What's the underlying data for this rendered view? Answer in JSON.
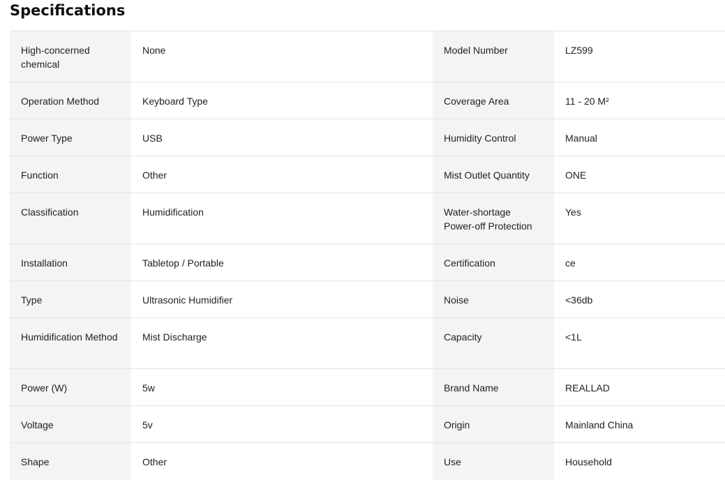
{
  "title": "Specifications",
  "rows": [
    {
      "k1": "High-concerned chemical",
      "v1": "None",
      "k2": "Model Number",
      "v2": "LZ599",
      "lines": 2
    },
    {
      "k1": "Operation Method",
      "v1": "Keyboard Type",
      "k2": "Coverage Area",
      "v2": "11 - 20 M²",
      "lines": 1
    },
    {
      "k1": "Power Type",
      "v1": "USB",
      "k2": "Humidity Control",
      "v2": "Manual",
      "lines": 1
    },
    {
      "k1": "Function",
      "v1": "Other",
      "k2": "Mist Outlet Quantity",
      "v2": "ONE",
      "lines": 1
    },
    {
      "k1": "Classification",
      "v1": "Humidification",
      "k2": "Water-shortage Power-off Protection",
      "v2": "Yes",
      "lines": 2
    },
    {
      "k1": "Installation",
      "v1": "Tabletop / Portable",
      "k2": "Certification",
      "v2": "ce",
      "lines": 1
    },
    {
      "k1": "Type",
      "v1": "Ultrasonic Humidifier",
      "k2": "Noise",
      "v2": "<36db",
      "lines": 1
    },
    {
      "k1": "Humidification Method",
      "v1": "Mist Discharge",
      "k2": "Capacity",
      "v2": "<1L",
      "lines": 2
    },
    {
      "k1": "Power (W)",
      "v1": "5w",
      "k2": "Brand Name",
      "v2": "REALLAD",
      "lines": 1
    },
    {
      "k1": "Voltage",
      "v1": "5v",
      "k2": "Origin",
      "v2": "Mainland China",
      "lines": 1
    },
    {
      "k1": "Shape",
      "v1": "Other",
      "k2": "Use",
      "v2": "Household",
      "lines": 1
    }
  ]
}
